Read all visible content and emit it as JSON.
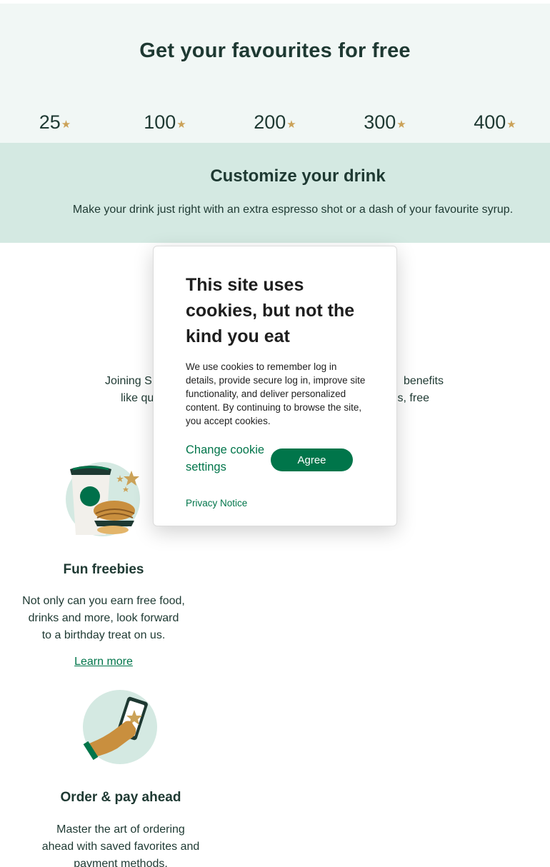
{
  "hero": {
    "title": "Get your favourites for free",
    "tabs": [
      {
        "value": "25",
        "star": "★"
      },
      {
        "value": "100",
        "star": "★"
      },
      {
        "value": "200",
        "star": "★"
      },
      {
        "value": "300",
        "star": "★"
      },
      {
        "value": "400",
        "star": "★"
      }
    ],
    "active_tab_index": 0
  },
  "panel": {
    "title": "Customize your drink",
    "text": "Make your drink just right with an extra espresso shot or a dash of your favourite syrup."
  },
  "join": {
    "line1_left": "Joining S",
    "line1_right": "benefits",
    "line2_left": "like qu",
    "line2_right": "s, free"
  },
  "features": [
    {
      "title": "Fun freebies",
      "description_lines": [
        "Not only can you earn free food,",
        "drinks and more, look forward",
        "to a birthday treat on us."
      ],
      "link": "Learn more"
    },
    {
      "title": "Order & pay ahead",
      "description_lines": [
        "Master the art of ordering",
        "ahead with saved favorites and",
        "payment methods."
      ]
    }
  ],
  "cookie": {
    "title": "This site uses cookies, but not the kind you eat",
    "body": "We use cookies to remember log in details, provide secure log in, improve site functionality, and deliver personalized content. By continuing to browse the site, you accept cookies.",
    "change_settings": "Change cookie settings",
    "agree": "Agree",
    "privacy": "Privacy Notice"
  },
  "colors": {
    "brand_green": "#00754a",
    "dark_green": "#1e3932",
    "light_green": "#d4e9e2",
    "hero_bg": "#f1f7f5",
    "gold": "#cba258"
  }
}
